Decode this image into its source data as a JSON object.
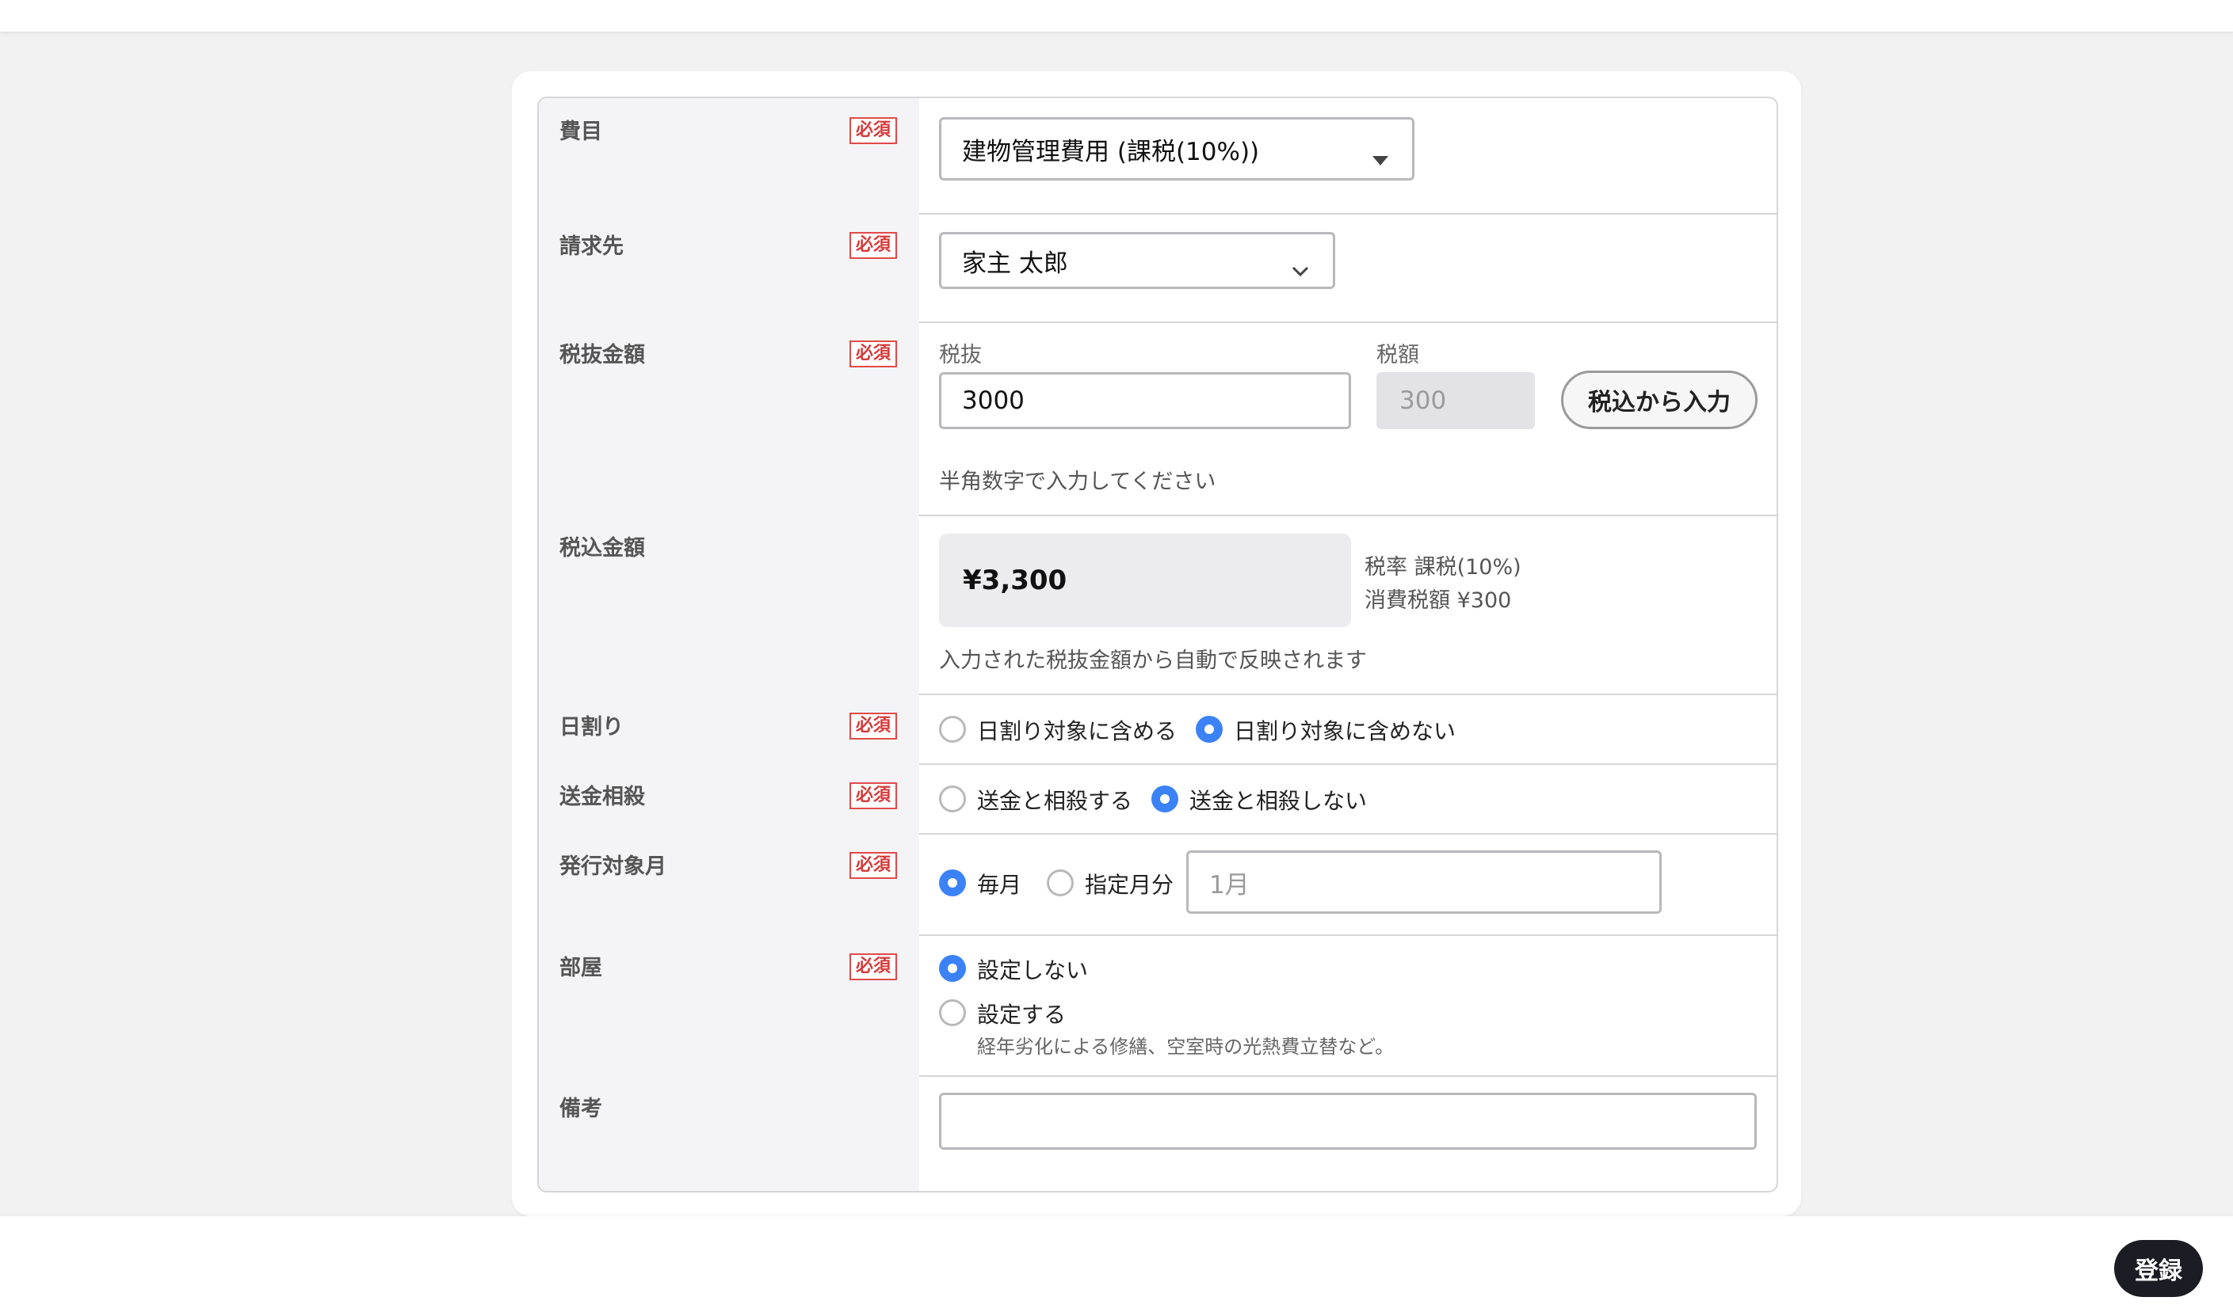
{
  "required_badge": "必須",
  "fields": {
    "himoku": {
      "label": "費目",
      "value": "建物管理費用 (課税(10%))",
      "icon": "caret-down-icon"
    },
    "seikyusaki": {
      "label": "請求先",
      "value": "家主 太郎",
      "icon": "chevron-down-icon"
    },
    "zeinuki": {
      "label": "税抜金額",
      "sub_label_excl": "税抜",
      "value_excl": "3000",
      "sub_label_tax": "税額",
      "value_tax": "300",
      "button": "税込から入力",
      "help": "半角数字で入力してください"
    },
    "zeikomi": {
      "label": "税込金額",
      "amount": "¥3,300",
      "tax_rate": "税率 課税(10%)",
      "tax_amount": "消費税額 ¥300",
      "help": "入力された税抜金額から自動で反映されます"
    },
    "hiwari": {
      "label": "日割り",
      "options": [
        "日割り対象に含める",
        "日割り対象に含めない"
      ],
      "selected": 1
    },
    "sokin": {
      "label": "送金相殺",
      "options": [
        "送金と相殺する",
        "送金と相殺しない"
      ],
      "selected": 1
    },
    "hakko": {
      "label": "発行対象月",
      "options": [
        "毎月",
        "指定月分"
      ],
      "selected": 0,
      "month_placeholder": "1月"
    },
    "heya": {
      "label": "部屋",
      "options": [
        "設定しない",
        "設定する"
      ],
      "selected": 0,
      "note": "経年劣化による修繕、空室時の光熱費立替など。"
    },
    "biko": {
      "label": "備考",
      "value": ""
    }
  },
  "submit_label": "登録",
  "colors": {
    "accent": "#3b82f6",
    "required": "#d63a3a",
    "submit_bg": "#1c1c24",
    "label_bg": "#f4f4f6"
  }
}
